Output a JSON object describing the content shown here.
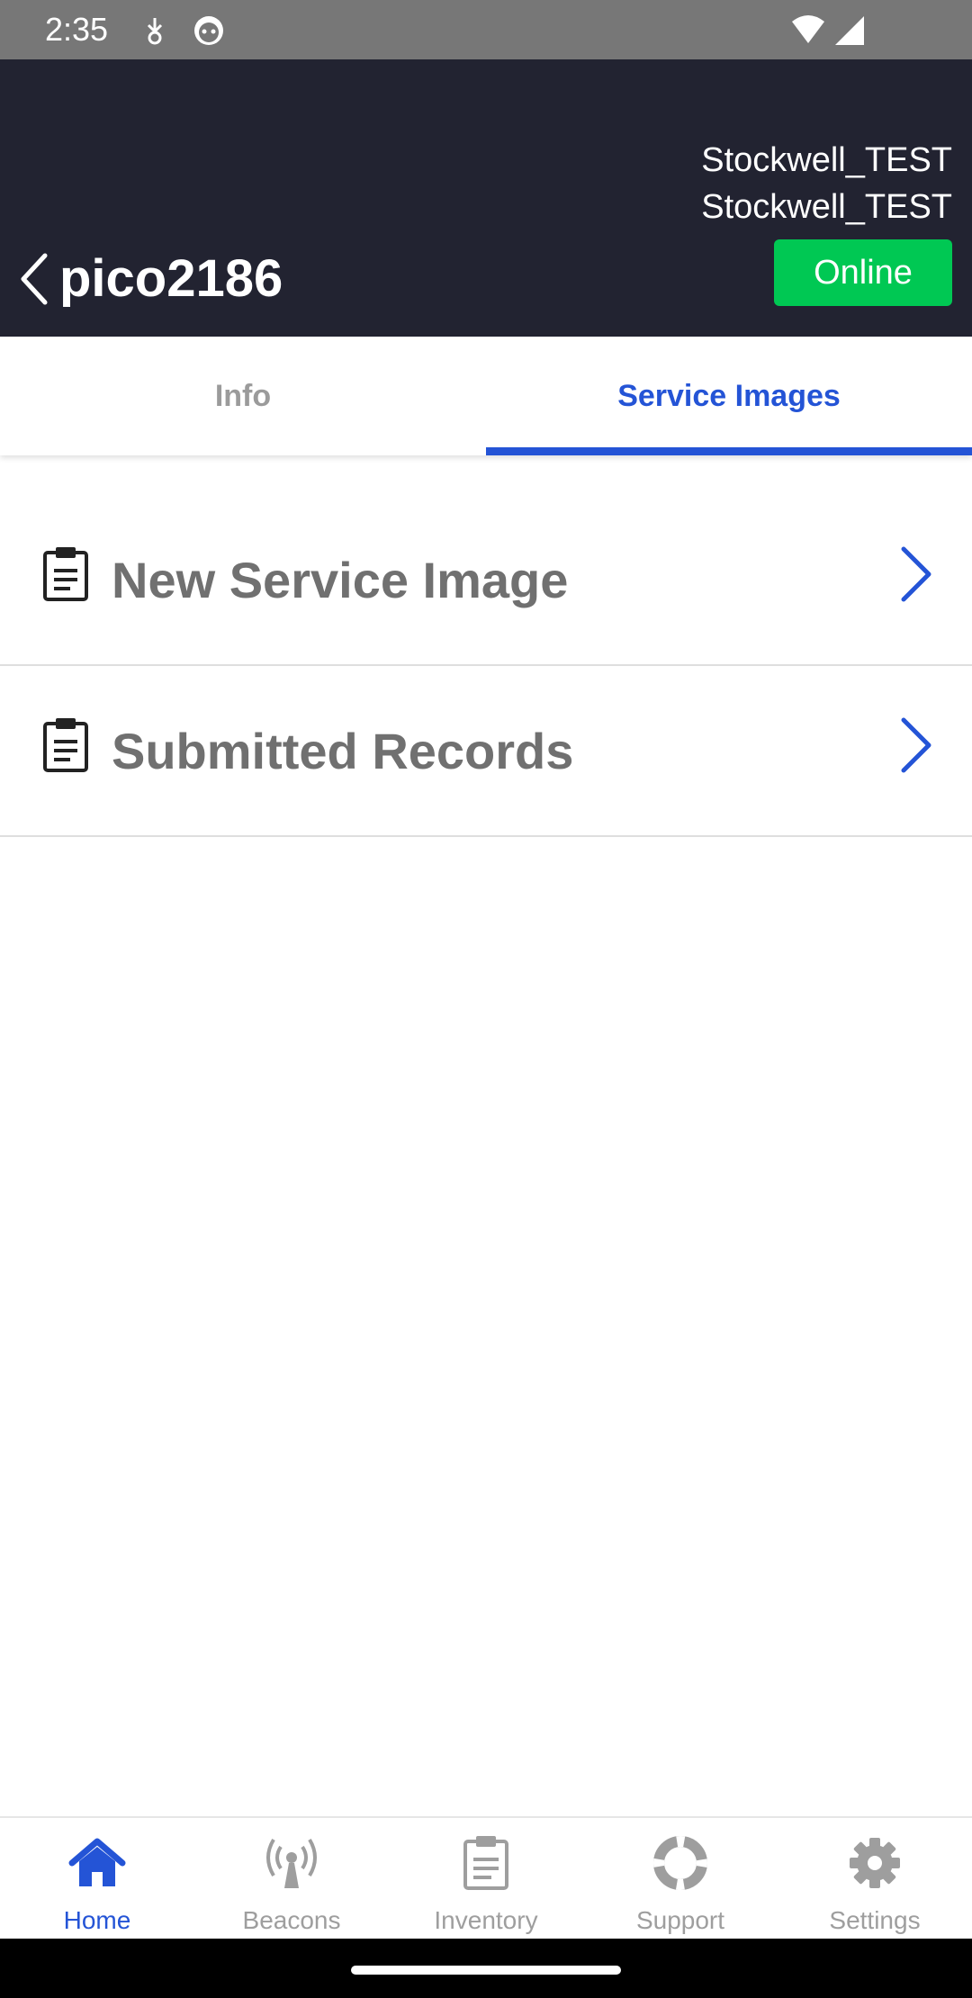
{
  "status_bar": {
    "time": "2:35",
    "icons": [
      "download-indicator-icon",
      "cat-face-icon",
      "wifi-icon",
      "cell-signal-icon"
    ]
  },
  "header": {
    "org_line_1": "Stockwell_TEST",
    "org_line_2": "Stockwell_TEST",
    "title": "pico2186",
    "status_badge": "Online",
    "colors": {
      "background": "#222331",
      "online": "#00c853"
    }
  },
  "tabs": [
    {
      "label": "Info",
      "active": false
    },
    {
      "label": "Service Images",
      "active": true
    }
  ],
  "list": [
    {
      "label": "New Service Image",
      "icon": "clipboard-icon"
    },
    {
      "label": "Submitted Records",
      "icon": "clipboard-icon"
    }
  ],
  "bottom_nav": [
    {
      "label": "Home",
      "icon": "home-icon",
      "active": true
    },
    {
      "label": "Beacons",
      "icon": "broadcast-icon",
      "active": false
    },
    {
      "label": "Inventory",
      "icon": "clipboard-icon",
      "active": false
    },
    {
      "label": "Support",
      "icon": "lifebuoy-icon",
      "active": false
    },
    {
      "label": "Settings",
      "icon": "gear-icon",
      "active": false
    }
  ],
  "accent_color": "#2454d6"
}
